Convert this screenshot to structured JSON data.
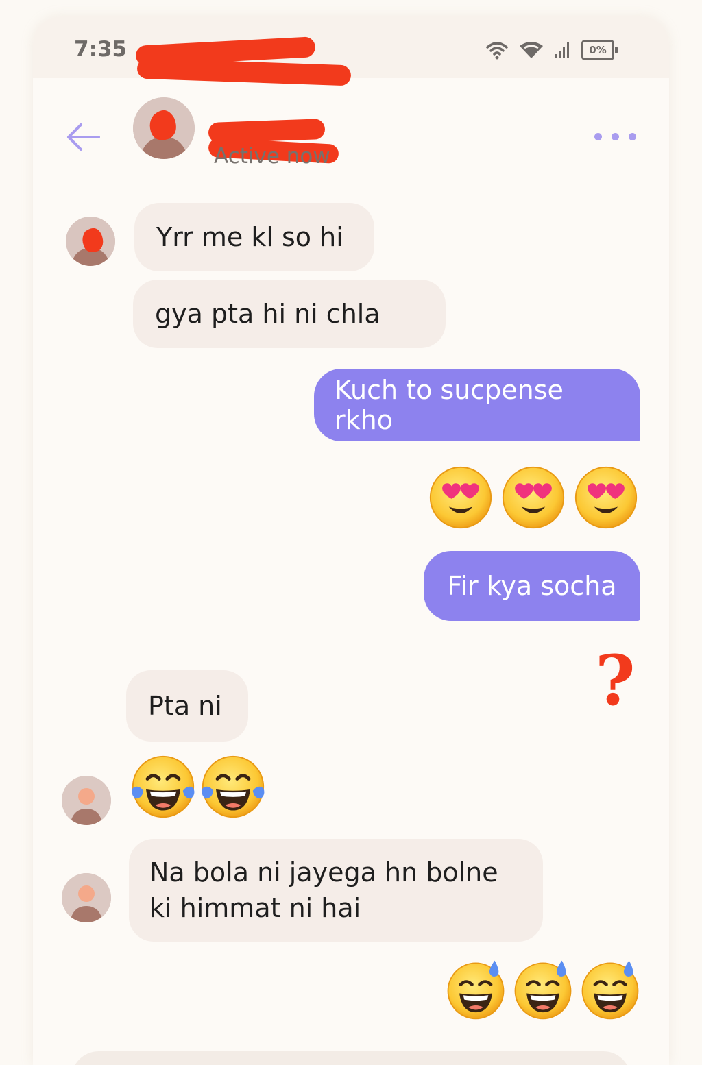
{
  "status_bar": {
    "time": "7:35",
    "battery": "0%"
  },
  "header": {
    "status": "Active now"
  },
  "messages": {
    "m1": "Yrr me kl so hi",
    "m2": "gya pta hi ni chla",
    "m3": "Kuch to sucpense rkho",
    "m4": "Fir kya socha",
    "m5": "Pta ni",
    "m6": "Na bola ni jayega hn bolne ki himmat ni hai"
  },
  "emoji_rows": {
    "heart_eyes": [
      "heart-eyes",
      "heart-eyes",
      "heart-eyes"
    ],
    "tears_of_joy": [
      "tears-of-joy",
      "tears-of-joy"
    ],
    "sweat_smile": [
      "sweat-smile",
      "sweat-smile",
      "sweat-smile"
    ]
  },
  "annotation": {
    "question_mark": "?"
  },
  "colors": {
    "outgoing": "#8d82ee",
    "incoming": "#f5ede8",
    "redaction": "#f23a1c",
    "accent": "#a99cef"
  }
}
